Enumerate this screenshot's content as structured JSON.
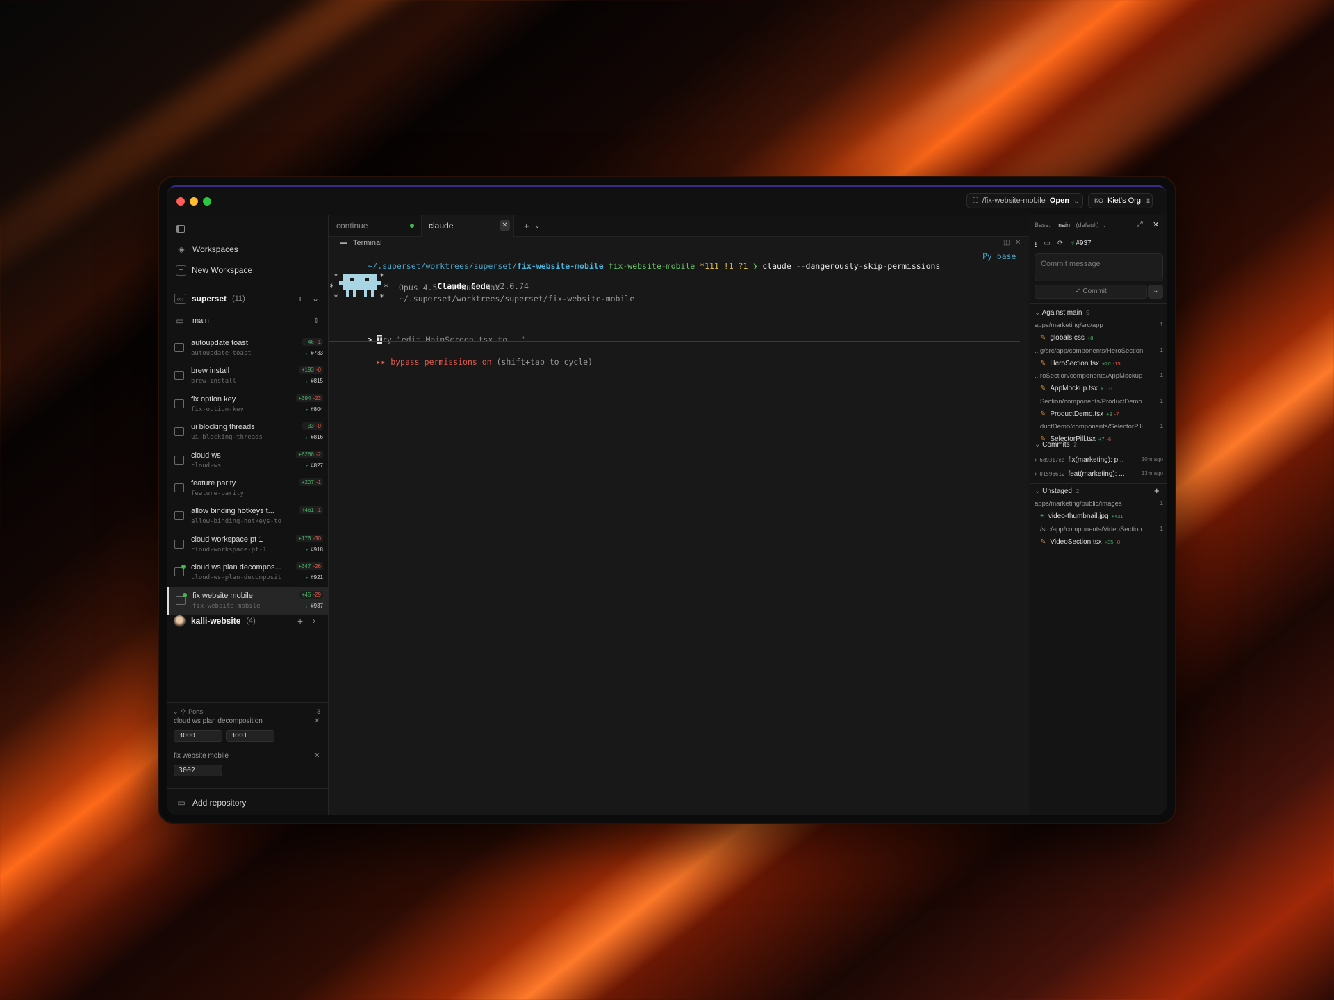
{
  "titlebar": {
    "branch_pill": "/fix-website-mobile",
    "open_label": "Open",
    "org_initials": "KO",
    "org_name": "Kiet's Org"
  },
  "sidebar": {
    "workspaces_label": "Workspaces",
    "new_workspace_label": "New Workspace",
    "repo_name": "superset",
    "repo_count": "(11)",
    "main_branch": "main",
    "workspaces": [
      {
        "name": "autoupdate toast",
        "branch": "autoupdate-toast",
        "add": "+46",
        "del": "-1",
        "pr": "#733",
        "dot": false
      },
      {
        "name": "brew install",
        "branch": "brew-install",
        "add": "+193",
        "del": "-0",
        "pr": "#815",
        "dot": false
      },
      {
        "name": "fix option key",
        "branch": "fix-option-key",
        "add": "+394",
        "del": "-23",
        "pr": "#804",
        "dot": false
      },
      {
        "name": "ui blocking threads",
        "branch": "ui-blocking-threads",
        "add": "+33",
        "del": "-0",
        "pr": "#816",
        "dot": false
      },
      {
        "name": "cloud ws",
        "branch": "cloud-ws",
        "add": "+6266",
        "del": "-2",
        "pr": "#827",
        "dot": false
      },
      {
        "name": "feature parity",
        "branch": "feature-parity",
        "add": "+207",
        "del": "-1",
        "pr": "",
        "dot": false
      },
      {
        "name": "allow binding hotkeys t...",
        "branch": "allow-binding-hotkeys-to-preset",
        "add": "+461",
        "del": "-1",
        "pr": "",
        "dot": false
      },
      {
        "name": "cloud workspace pt 1",
        "branch": "cloud-workspace-pt-1",
        "add": "+176",
        "del": "-30",
        "pr": "#918",
        "dot": false
      },
      {
        "name": "cloud ws plan decompos...",
        "branch": "cloud-ws-plan-decomposit...",
        "add": "+347",
        "del": "-26",
        "pr": "#921",
        "dot": true
      },
      {
        "name": "fix website mobile",
        "branch": "fix-website-mobile",
        "add": "+45",
        "del": "-29",
        "pr": "#937",
        "dot": true
      }
    ],
    "repo2_name": "kalli-website",
    "repo2_count": "(4)",
    "ports_label": "Ports",
    "ports_count": "3",
    "port_groups": [
      {
        "name": "cloud ws plan decomposition",
        "ports": [
          "3000",
          "3001"
        ]
      },
      {
        "name": "fix website mobile",
        "ports": [
          "3002"
        ]
      }
    ],
    "add_repo_label": "Add repository"
  },
  "tabs": [
    {
      "label": "continue",
      "status_color": "#3fb950"
    },
    {
      "label": "claude"
    }
  ],
  "terminal": {
    "pane_title": "Terminal",
    "prompt_path_prefix": "~/.superset/worktrees/superset/",
    "prompt_path_bold": "fix-website-mobile",
    "prompt_branch": "fix-website-mobile",
    "prompt_status": "*111 !1 ?1",
    "prompt_arrow": "❯",
    "command": "claude --dangerously-skip-permissions",
    "env": "Py base",
    "app_name": "Claude Code",
    "app_version": "v2.0.74",
    "model_line": "Opus 4.5 · Claude Max",
    "cwd_line": "~/.superset/worktrees/superset/fix-website-mobile",
    "input_prefix": ">",
    "input_placeholder": "Try \"edit MainScreen.tsx to...\"",
    "bypass_arrows": "▸▸",
    "bypass_text": "bypass permissions on",
    "bypass_hint": "(shift+tab to cycle)"
  },
  "right_panel": {
    "base_label": "Base:",
    "base_branch": "main",
    "base_default": "(default)",
    "pr_number": "#937",
    "commit_placeholder": "Commit message",
    "commit_label": "Commit",
    "against_label": "Against main",
    "against_count": "5",
    "against_files": [
      {
        "dir": "apps/marketing/src/app",
        "dir_count": "1",
        "file": "globals.css",
        "add": "+8",
        "del": ""
      },
      {
        "dir": "...g/src/app/components/HeroSection",
        "dir_count": "1",
        "file": "HeroSection.tsx",
        "add": "+20",
        "del": "-15"
      },
      {
        "dir": "...roSection/components/AppMockup",
        "dir_count": "1",
        "file": "AppMockup.tsx",
        "add": "+1",
        "del": "-1"
      },
      {
        "dir": "...Section/components/ProductDemo",
        "dir_count": "1",
        "file": "ProductDemo.tsx",
        "add": "+9",
        "del": "-7"
      },
      {
        "dir": "...ductDemo/components/SelectorPill",
        "dir_count": "1",
        "file": "SelectorPill.tsx",
        "add": "+7",
        "del": "-6"
      }
    ],
    "commits_label": "Commits",
    "commits_count": "2",
    "commits": [
      {
        "hash": "6d9317ea",
        "msg": "fix(marketing): p...",
        "time": "10m ago"
      },
      {
        "hash": "01596612",
        "msg": "feat(marketing): ...",
        "time": "13m ago"
      }
    ],
    "unstaged_label": "Unstaged",
    "unstaged_count": "2",
    "unstaged_files": [
      {
        "dir": "apps/marketing/public/images",
        "dir_count": "1",
        "file": "video-thumbnail.jpg",
        "add": "+431",
        "del": "",
        "new": true
      },
      {
        "dir": ".../src/app/components/VideoSection",
        "dir_count": "1",
        "file": "VideoSection.tsx",
        "add": "+35",
        "del": "-8",
        "new": false
      }
    ]
  }
}
